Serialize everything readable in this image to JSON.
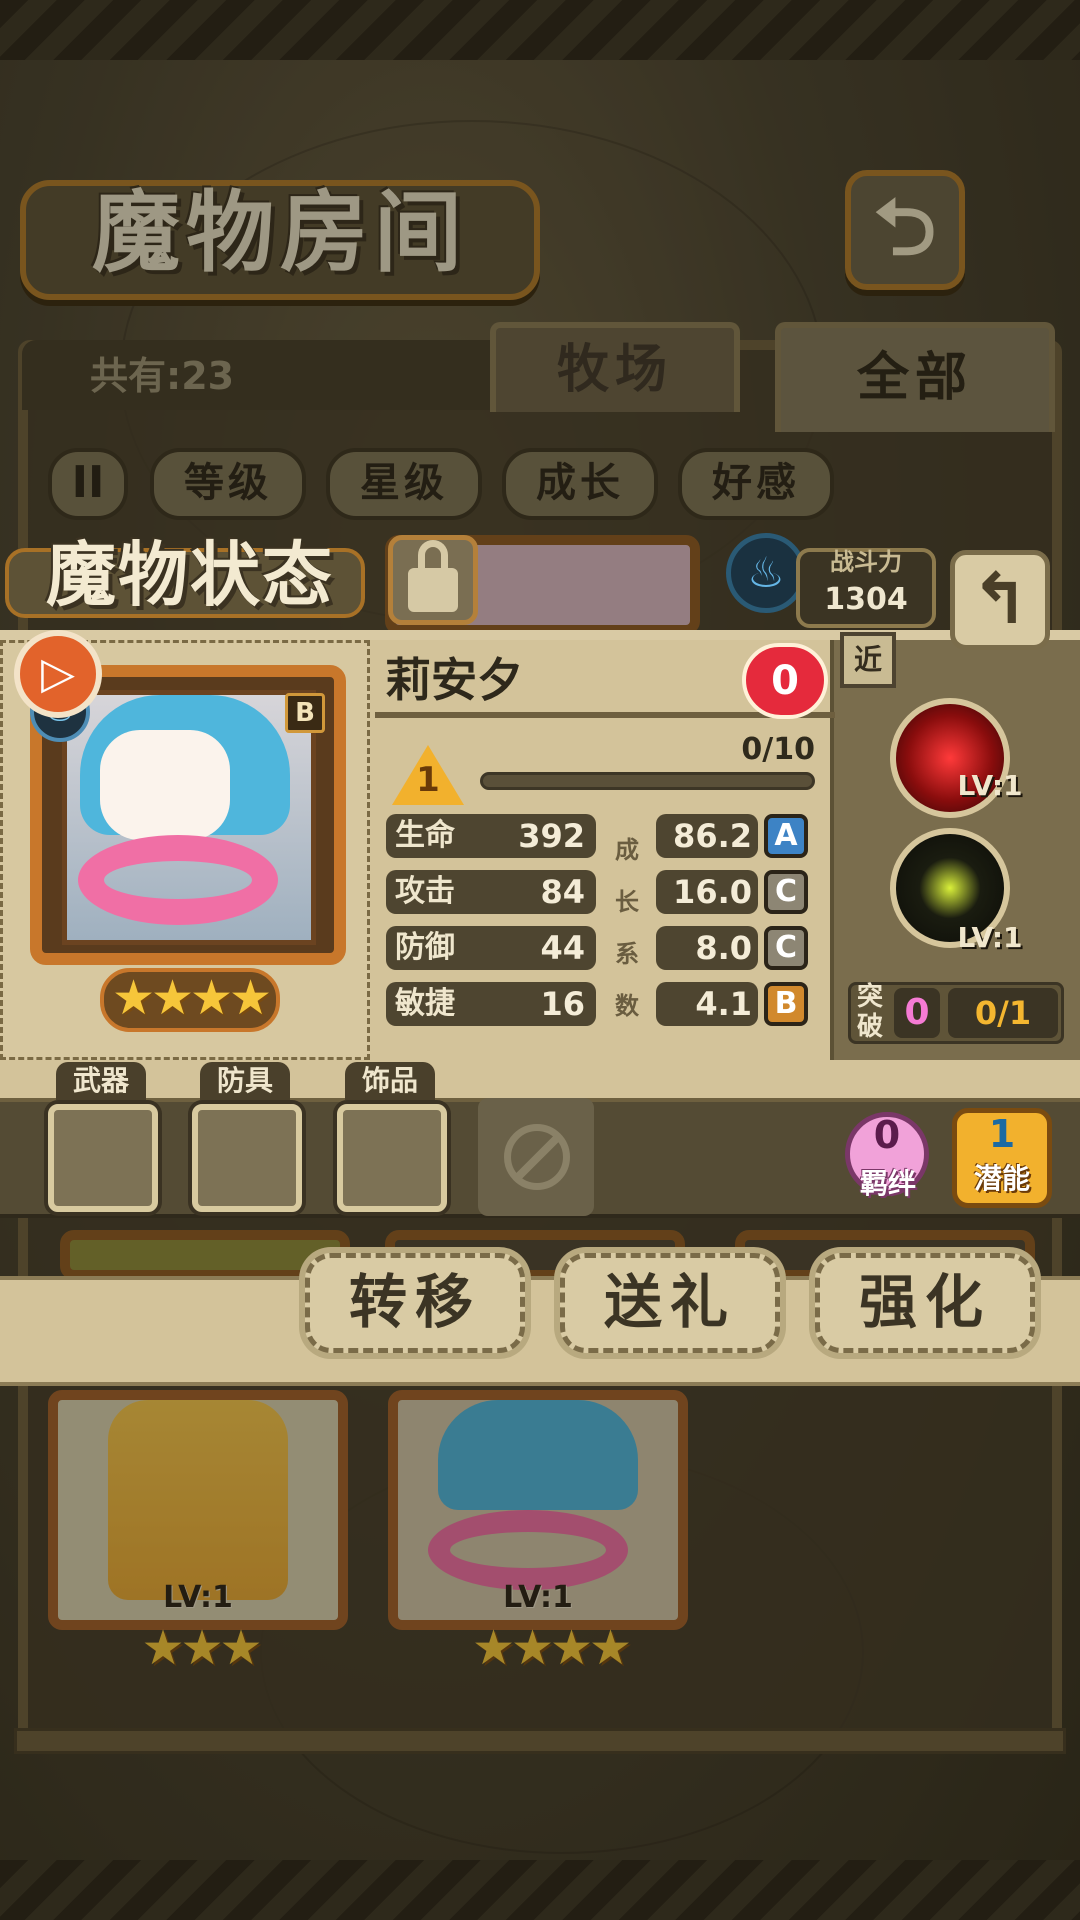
{
  "header": {
    "title": "魔物房间",
    "back_icon": "return-arrow-icon"
  },
  "collection": {
    "count_text": "共有:23"
  },
  "tabs": [
    {
      "label": "牧场"
    },
    {
      "label": "全部"
    }
  ],
  "sort": {
    "toggle_icon": "pause-sort-icon",
    "buttons": [
      {
        "label": "等级"
      },
      {
        "label": "星级"
      },
      {
        "label": "成长"
      },
      {
        "label": "好感"
      }
    ]
  },
  "status": {
    "title": "魔物状态",
    "power_label": "战斗力",
    "power_value": "1304",
    "monster": {
      "name": "莉安夕",
      "rank": "B",
      "stars": "★★★★",
      "heart_value": "0",
      "level": "1",
      "exp_text": "0/10",
      "exp_progress": 0.0
    },
    "stats": [
      {
        "label": "生命",
        "value": "392",
        "growth": "86.2",
        "grade": "A"
      },
      {
        "label": "攻击",
        "value": "84",
        "growth": "16.0",
        "grade": "C"
      },
      {
        "label": "防御",
        "value": "44",
        "growth": "8.0",
        "grade": "C"
      },
      {
        "label": "敏捷",
        "value": "16",
        "growth": "4.1",
        "grade": "B"
      }
    ],
    "growth_vertical": [
      "成",
      "长",
      "系",
      "数"
    ],
    "range_tag": "近",
    "skills": [
      {
        "lv": "LV:1"
      },
      {
        "lv": "LV:1"
      }
    ],
    "breakthrough": {
      "label": "突破",
      "count": "0",
      "progress": "0/1"
    }
  },
  "equipment": {
    "slots": [
      {
        "label": "武器"
      },
      {
        "label": "防具"
      },
      {
        "label": "饰品"
      }
    ]
  },
  "bond": {
    "value": "0",
    "label": "羁绊"
  },
  "potential": {
    "value": "1",
    "label": "潜能"
  },
  "actions": [
    {
      "label": "转移"
    },
    {
      "label": "送礼"
    },
    {
      "label": "强化"
    }
  ],
  "list_cards": [
    {
      "lv": "LV:1",
      "stars": "★★★"
    },
    {
      "lv": "LV:1",
      "stars": "★★★★"
    }
  ],
  "colors": {
    "accent_orange": "#c8772b",
    "parchment": "#d3c39a",
    "dark_brown": "#4e4530",
    "heart_red": "#e52a3c",
    "gold": "#f4b630"
  }
}
